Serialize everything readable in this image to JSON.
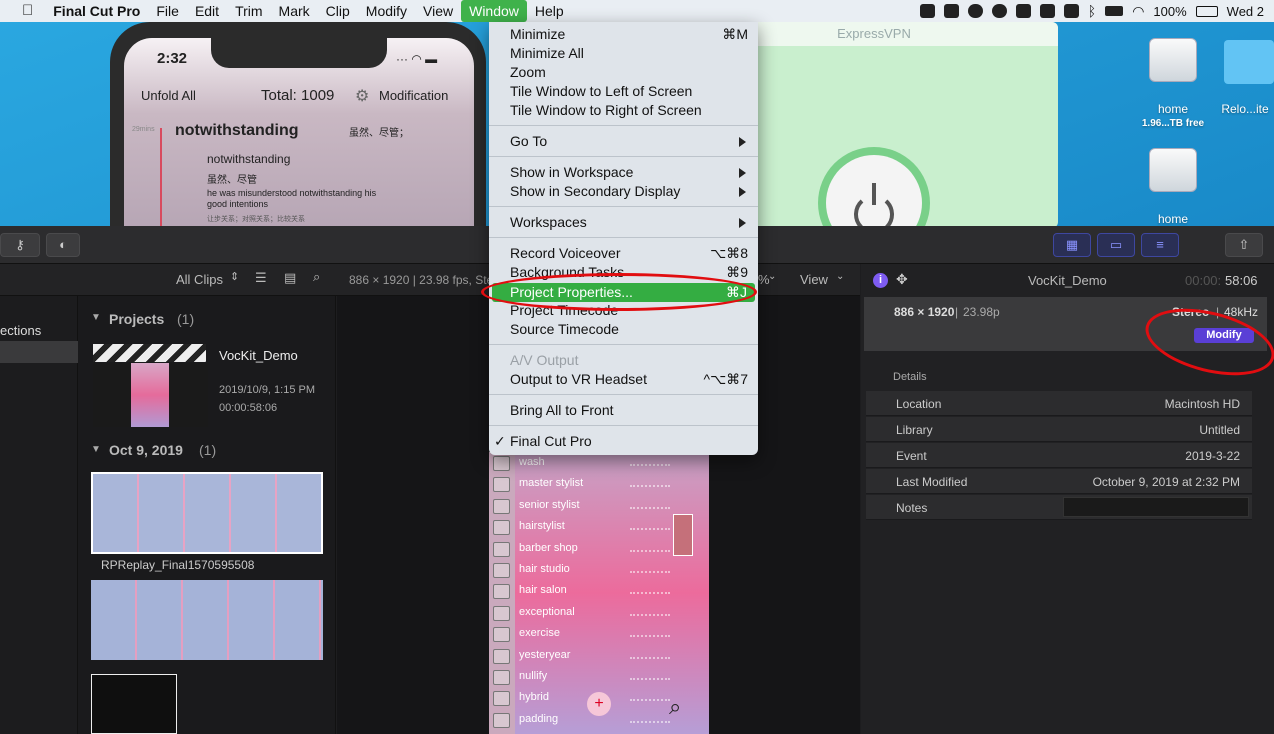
{
  "menubar": {
    "app_name": "Final Cut Pro",
    "items": [
      "File",
      "Edit",
      "Trim",
      "Mark",
      "Clip",
      "Modify",
      "View",
      "Window",
      "Help"
    ],
    "active_item": "Window",
    "battery": "100%",
    "clock": "Wed 2"
  },
  "phone": {
    "time": "2:32",
    "unfold_label": "Unfold All",
    "total_label": "Total: 1009",
    "modification_label": "Modification",
    "tag": "29mins",
    "headword": "notwithstanding",
    "headword_cn": "虽然、尽管；",
    "sub_word": "notwithstanding",
    "sub_cn": "虽然、尽管",
    "example": "he was misunderstood notwithstanding his",
    "example2": "good intentions",
    "note": "让步关系；对照关系；比较关系"
  },
  "vpn": {
    "title": "ExpressVPN"
  },
  "desktop_icons": [
    {
      "label": "home",
      "sub": "1.96...TB free"
    },
    {
      "label": "Relo...ite",
      "sub": ""
    },
    {
      "label": "home",
      "sub": ""
    }
  ],
  "browser": {
    "filter_label": "All Clips",
    "sidebar_label": "ections",
    "format_info": "886 × 1920 | 23.98 fps, Ste",
    "zoom_partial": "%",
    "view_label": "View",
    "projects_header": "Projects",
    "projects_count": "(1)",
    "project": {
      "name": "VocKit_Demo",
      "date": "2019/10/9, 1:15 PM",
      "duration": "00:00:58:06"
    },
    "event_header": "Oct 9, 2019",
    "event_count": "(1)",
    "clip_name": "RPReplay_Final1570595508"
  },
  "video_rows": [
    "wash",
    "master stylist",
    "senior stylist",
    "hairstylist",
    "barber shop",
    "hair studio",
    "hair salon",
    "exceptional",
    "exercise",
    "yesteryear",
    "nullify",
    "hybrid",
    "padding"
  ],
  "inspector": {
    "title": "VocKit_Demo",
    "timecode_dim": "00:00:",
    "timecode": "58:06",
    "format": "886 × 1920",
    "fps": "23.98p",
    "audio": "Stereo",
    "audio_rate": "48kHz",
    "modify_label": "Modify",
    "details_header": "Details",
    "rows": [
      {
        "key": "Location",
        "value": "Macintosh HD"
      },
      {
        "key": "Library",
        "value": "Untitled"
      },
      {
        "key": "Event",
        "value": "2019-3-22"
      },
      {
        "key": "Last Modified",
        "value": "October 9, 2019 at 2:32 PM"
      },
      {
        "key": "Notes",
        "value": ""
      }
    ]
  },
  "window_menu": {
    "minimize": "Minimize",
    "minimize_key": "⌘M",
    "minimize_all": "Minimize All",
    "zoom": "Zoom",
    "tile_left": "Tile Window to Left of Screen",
    "tile_right": "Tile Window to Right of Screen",
    "go_to": "Go To",
    "show_workspace": "Show in Workspace",
    "show_secondary": "Show in Secondary Display",
    "workspaces": "Workspaces",
    "record_voiceover": "Record Voiceover",
    "record_key": "⌥⌘8",
    "background_tasks": "Background Tasks",
    "background_key": "⌘9",
    "project_properties": "Project Properties...",
    "project_key": "⌘J",
    "project_timecode": "Project Timecode",
    "source_timecode": "Source Timecode",
    "av_output": "A/V Output",
    "vr_headset": "Output to VR Headset",
    "vr_key": "^⌥⌘7",
    "bring_front": "Bring All to Front",
    "checkmark": "✓",
    "final_cut": "Final Cut Pro"
  },
  "colors": {
    "menu_highlight": "#34ad42",
    "annotation": "#e10d10",
    "modify_button": "#5a3fd6"
  }
}
